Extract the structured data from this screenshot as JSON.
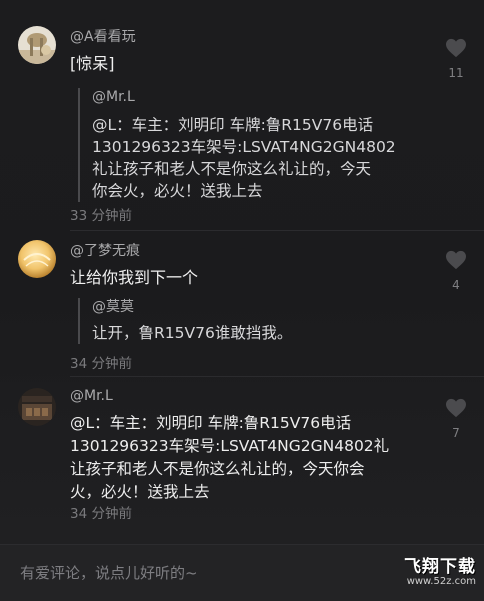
{
  "comments": [
    {
      "username": "@A看看玩",
      "text": "[惊呆]",
      "quote": {
        "username": "@Mr.L",
        "lines": [
          "@L：车主：刘明印 车牌:鲁R15V76电话",
          "1301296323车架号:LSVAT4NG2GN4802",
          "礼让孩子和老人不是你这么礼让的，今天",
          "你会火，必火！送我上去"
        ]
      },
      "time": "33 分钟前",
      "likes": "11"
    },
    {
      "username": "@了梦无痕",
      "text": "让给你我到下一个",
      "quote": {
        "username": "@莫莫",
        "lines": [
          "让开，鲁R15V76谁敢挡我。"
        ]
      },
      "time": "34 分钟前",
      "likes": "4"
    },
    {
      "username": "@Mr.L",
      "lines": [
        "@L：车主：刘明印 车牌:鲁R15V76电话",
        "1301296323车架号:LSVAT4NG2GN4802礼",
        "让孩子和老人不是你这么礼让的，今天你会",
        "火，必火！送我上去"
      ],
      "time": "34 分钟前",
      "likes": "7"
    }
  ],
  "input": {
    "placeholder": "有爱评论，说点儿好听的~"
  },
  "watermark": {
    "title": "飞翔下载",
    "url": "www.52z.com"
  },
  "colors": {
    "background": "#1a1a1c",
    "text": "#f0f0f0",
    "muted": "#7a7a7d",
    "heart": "#4b4b4e"
  },
  "icons": {
    "like": "heart-icon"
  }
}
